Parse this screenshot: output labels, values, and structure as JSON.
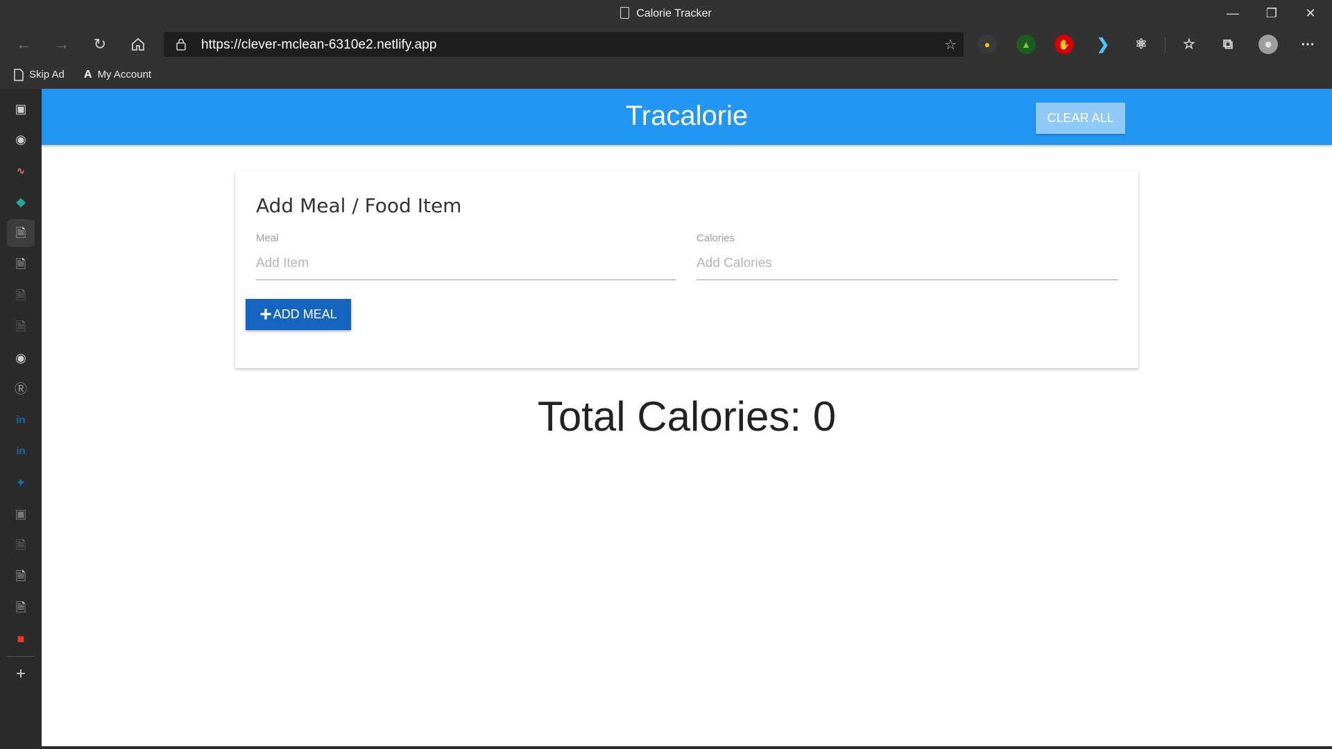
{
  "window": {
    "title": "Calorie Tracker"
  },
  "toolbar": {
    "url": "https://clever-mclean-6310e2.netlify.app"
  },
  "bookmarks": [
    {
      "label": "Skip Ad",
      "icon": "page-icon"
    },
    {
      "label": "My Account",
      "icon": "account-a-icon"
    }
  ],
  "app": {
    "brand": "Tracalorie",
    "clear_all_label": "CLEAR ALL",
    "card_title": "Add Meal / Food Item",
    "meal_label": "Meal",
    "meal_placeholder": "Add Item",
    "meal_value": "",
    "calories_label": "Calories",
    "calories_placeholder": "Add Calories",
    "calories_value": "",
    "add_meal_label": "ADD MEAL",
    "total_text": "Total Calories: 0"
  },
  "colors": {
    "appbar": "#2196f3",
    "clear_button": "#90caf9",
    "add_button": "#1565c0"
  }
}
